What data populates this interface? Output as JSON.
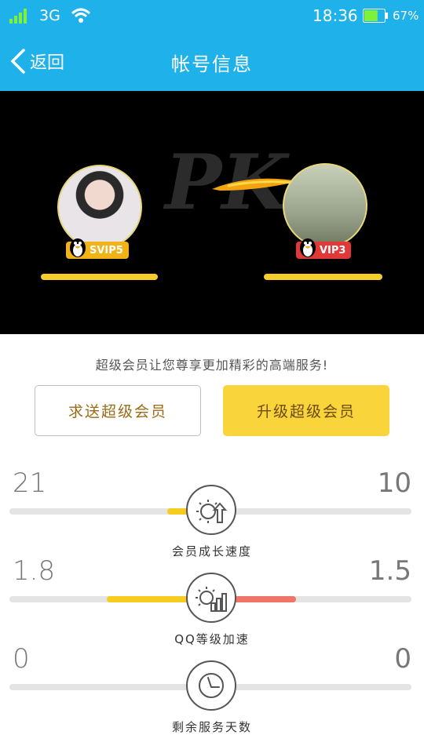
{
  "status_bar": {
    "network": "3G",
    "time": "18:36",
    "battery_percent": "67%",
    "battery_level": 0.67,
    "icons": [
      "signal-icon",
      "wifi-icon",
      "battery-icon"
    ]
  },
  "nav": {
    "back_label": "返回",
    "title": "帐号信息"
  },
  "pk": {
    "left_user": {
      "badge": "SVIP5",
      "badge_color": "#f0b419"
    },
    "right_user": {
      "badge": "VIP3",
      "badge_color": "#e13838"
    },
    "art_text": "PK",
    "accent": "#f6cd2b"
  },
  "promo": {
    "text": "超级会员让您尊享更加精彩的高端服务!",
    "gift_button": "求送超级会员",
    "upgrade_button": "升级超级会员"
  },
  "stats": [
    {
      "left": "21",
      "right": "10",
      "label": "会员成长速度",
      "icon": "growth-icon",
      "left_fill": 0.11,
      "right_fill": 0.04
    },
    {
      "left": "1.8",
      "right": "1.5",
      "label": "QQ等级加速",
      "icon": "level-speed-icon",
      "left_fill": 0.26,
      "right_fill": 0.21
    },
    {
      "left": "0",
      "right": "0",
      "label": "剩余服务天数",
      "icon": "clock-icon",
      "left_fill": 0,
      "right_fill": 0
    }
  ],
  "colors": {
    "primary": "#1fb2ea",
    "yellow": "#f6cd1f",
    "red": "#f07468",
    "track": "#e4e4e4"
  }
}
